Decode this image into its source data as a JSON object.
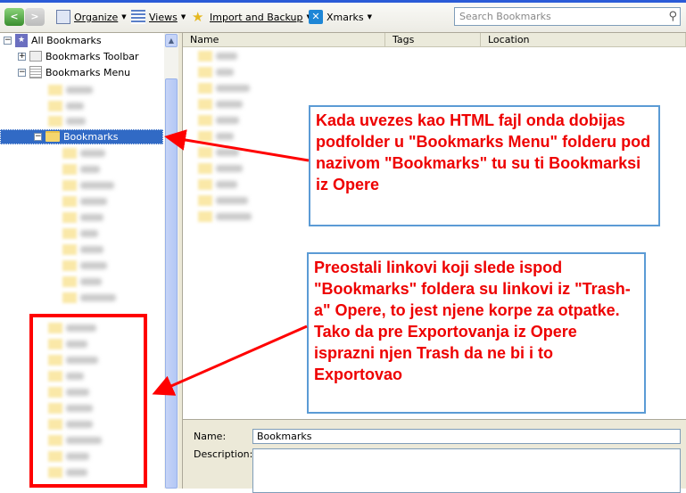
{
  "toolbar": {
    "back": "<",
    "forward": ">",
    "organize": "Organize",
    "views": "Views",
    "import_backup": "Import and Backup",
    "xmarks": "Xmarks",
    "search_placeholder": "Search Bookmarks"
  },
  "tree": {
    "all": "All Bookmarks",
    "toolbar": "Bookmarks Toolbar",
    "menu": "Bookmarks Menu",
    "selected": "Bookmarks"
  },
  "columns": [
    "Name",
    "Tags",
    "Location"
  ],
  "details": {
    "name_label": "Name:",
    "name_value": "Bookmarks",
    "description_label": "Description:"
  },
  "annotations": {
    "note1": "Kada uvezes kao HTML fajl onda dobijas podfolder u \"Bookmarks Menu\" folderu pod nazivom \"Bookmarks\" tu su ti Bookmarksi iz Opere",
    "note2": "Preostali linkovi koji slede ispod \"Bookmarks\" foldera su linkovi iz \"Trash-a\" Opere, to jest njene korpe za otpatke. Tako da pre Exportovanja iz Opere isprazni njen Trash da ne bi i to Exportovao",
    "color_text": "#ee0000",
    "color_border": "#5b9bd5",
    "color_highlight": "#ff0000"
  }
}
